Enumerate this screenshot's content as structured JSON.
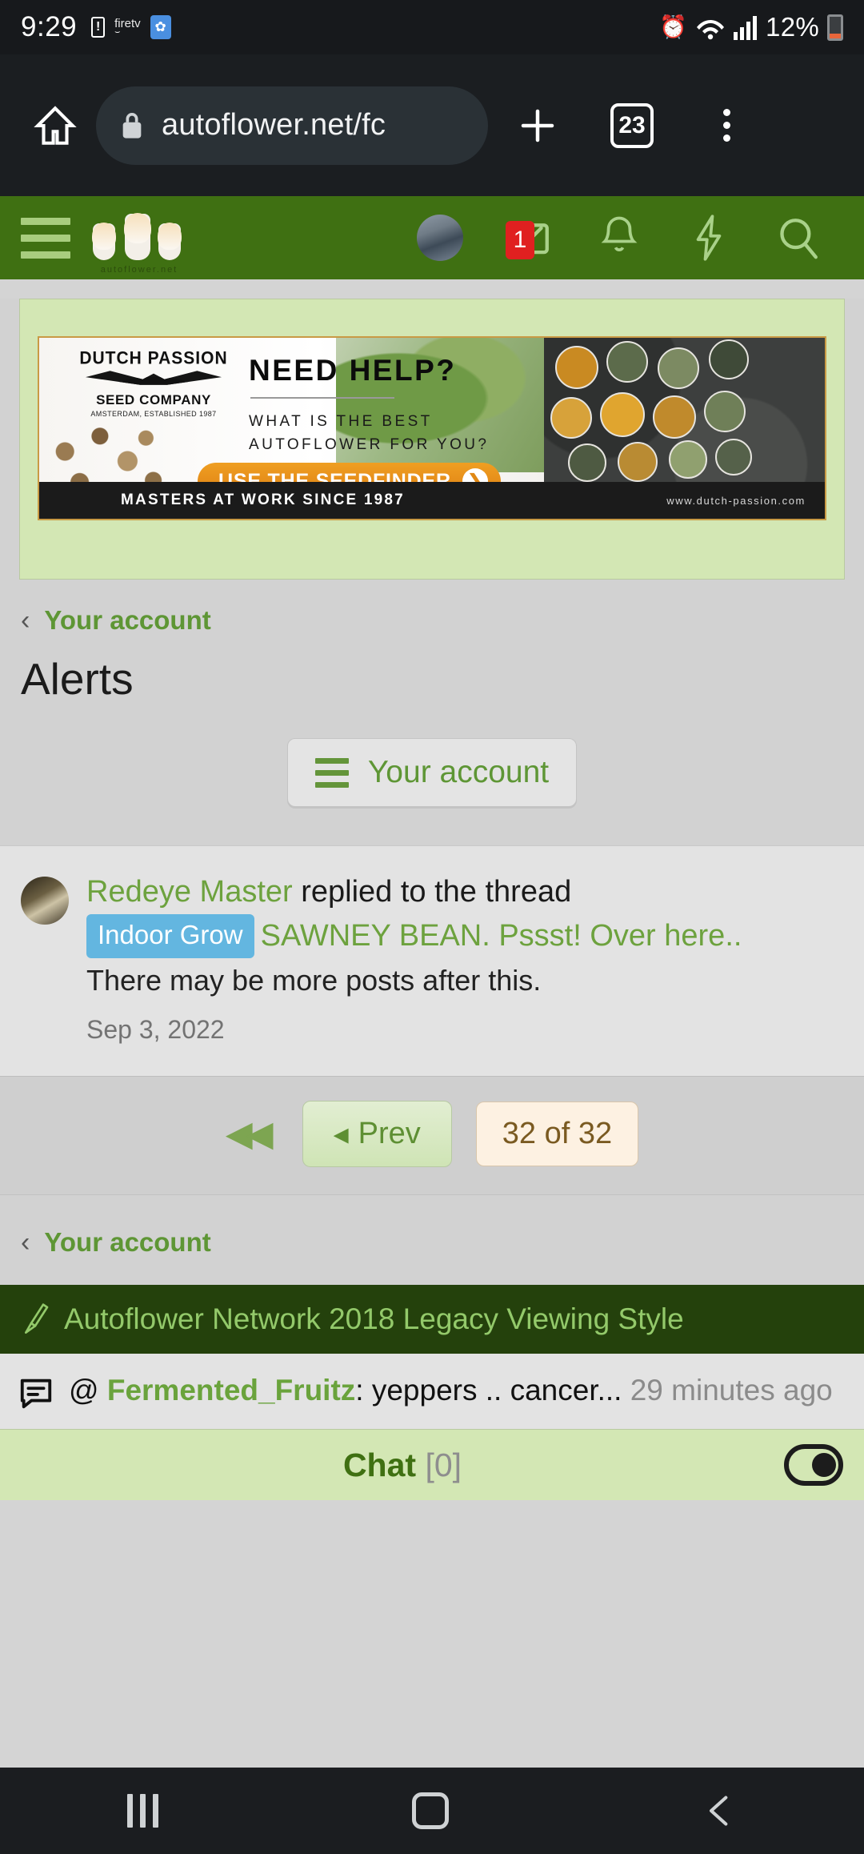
{
  "status_bar": {
    "clock": "9:29",
    "battery_alert_icon": "battery-alert-icon",
    "firetv_label": "firetv",
    "blue_app_icon": "app-icon",
    "alarm_icon": "alarm-icon",
    "wifi_icon": "wifi-icon",
    "signal_icon": "signal-icon",
    "battery_percent": "12%",
    "battery_icon": "battery-icon"
  },
  "browser": {
    "home_icon": "home-icon",
    "lock_icon": "lock-icon",
    "url": "autoflower.net/fc",
    "new_tab_icon": "plus-icon",
    "tab_count": "23",
    "menu_icon": "kebab-menu-icon"
  },
  "site_header": {
    "menu_icon": "hamburger-icon",
    "logo_caption": "autoflower.net",
    "avatar": "user-avatar",
    "inbox_icon": "envelope-icon",
    "inbox_badge": "1",
    "alerts_icon": "bell-icon",
    "whats_new_icon": "lightning-bolt-icon",
    "search_icon": "search-icon"
  },
  "ad": {
    "brand": "DUTCH PASSION",
    "brand_mark": "®",
    "brand_sub": "SEED COMPANY",
    "brand_sub2": "AMSTERDAM, ESTABLISHED 1987",
    "headline": "NEED HELP?",
    "question_line1": "WHAT IS THE BEST",
    "question_line2": "AUTOFLOWER FOR YOU?",
    "cta_label": "USE THE SEEDFINDER",
    "cta_arrow": "❯",
    "footer_tagline": "MASTERS AT WORK SINCE 1987",
    "footer_site": "www.dutch-passion.com"
  },
  "breadcrumb_top": {
    "chevron": "‹",
    "label": "Your account"
  },
  "page_title": "Alerts",
  "account_button": {
    "label": "Your account",
    "icon": "hamburger-icon"
  },
  "alert": {
    "username": "Redeye Master",
    "action": " replied to the thread",
    "prefix_tag": "Indoor Grow",
    "thread_title": "SAWNEY BEAN. Pssst! Over here..",
    "note": "There may be more posts after this.",
    "date": "Sep 3, 2022"
  },
  "pagination": {
    "first_icon": "◀◀",
    "prev_arrow": "◂",
    "prev_label": "Prev",
    "count_label": "32 of 32"
  },
  "breadcrumb_bottom": {
    "chevron": "‹",
    "label": "Your account"
  },
  "style_bar": {
    "icon": "paintbrush-icon",
    "label": "Autoflower Network 2018 Legacy Viewing Style"
  },
  "chat_line": {
    "icon": "chat-bubble-icon",
    "at": "@ ",
    "username": "Fermented_Fruitz",
    "message": ": yeppers .. cancer... ",
    "time": "29 minutes ago"
  },
  "chat_bar": {
    "title": "Chat ",
    "count": "[0]",
    "toggle": "chat-toggle"
  },
  "nav_bar": {
    "recents_icon": "recents-icon",
    "home_icon": "home-icon",
    "back_icon": "back-icon"
  },
  "colors": {
    "brand_green": "#3f7012",
    "link_green": "#6da23e",
    "dark_green": "#24410c",
    "pale_green": "#d3e7b4",
    "tag_blue": "#63b6e0",
    "badge_red": "#e02020",
    "cta_orange": "#e08814"
  }
}
